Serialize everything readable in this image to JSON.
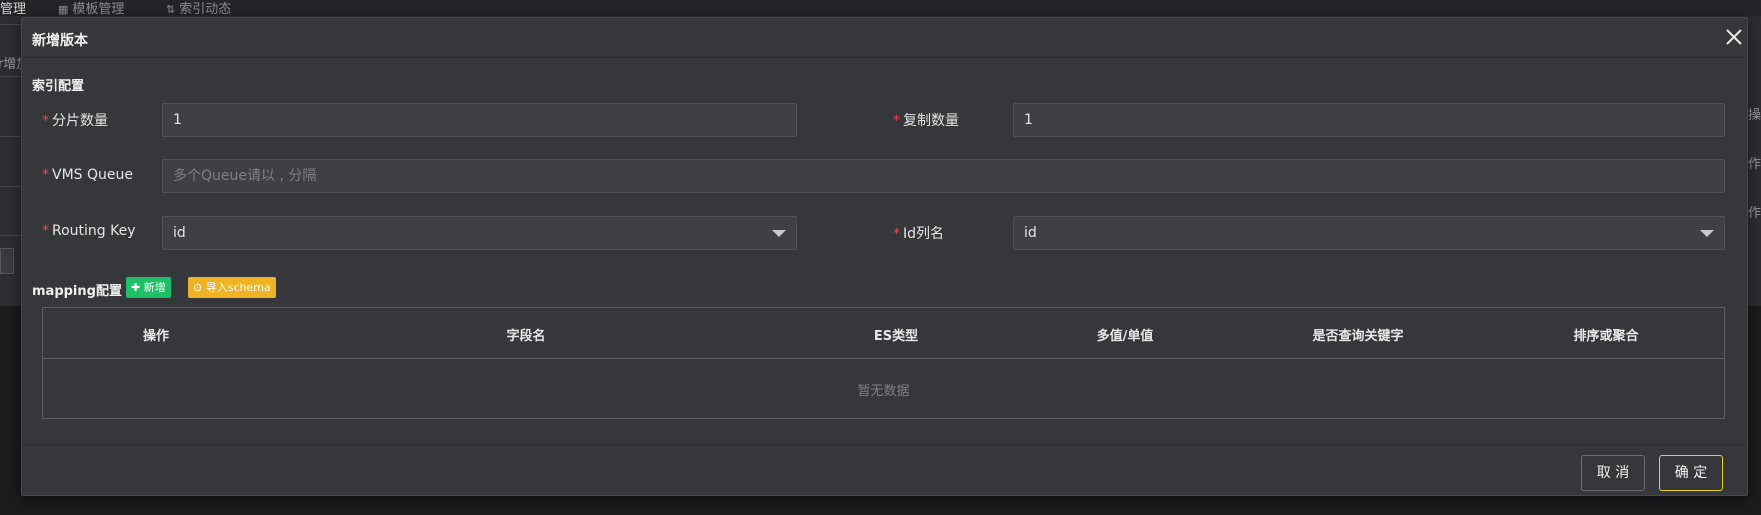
{
  "background": {
    "nav_tabs": [
      "管理",
      "模板管理",
      "索引动态"
    ],
    "left_fragment": "r增加",
    "right_fragments": [
      "操",
      "作",
      "作"
    ]
  },
  "dialog": {
    "title": "新增版本",
    "index_section": "索引配置",
    "fields": {
      "shards": {
        "label": "分片数量",
        "value": "1"
      },
      "replicas": {
        "label": "复制数量",
        "value": "1"
      },
      "vms_queue": {
        "label": "VMS Queue",
        "placeholder": "多个Queue请以 , 分隔",
        "value": ""
      },
      "routing_key": {
        "label": "Routing Key",
        "value": "id"
      },
      "id_column": {
        "label": "Id列名",
        "value": "id"
      }
    },
    "mapping": {
      "title": "mapping配置",
      "add_button": "新增",
      "import_button": "导入schema",
      "columns": [
        "操作",
        "字段名",
        "ES类型",
        "多值/单值",
        "是否查询关键字",
        "排序或聚合"
      ],
      "empty_text": "暂无数据"
    },
    "cancel_button": "取 消",
    "ok_button": "确 定"
  }
}
